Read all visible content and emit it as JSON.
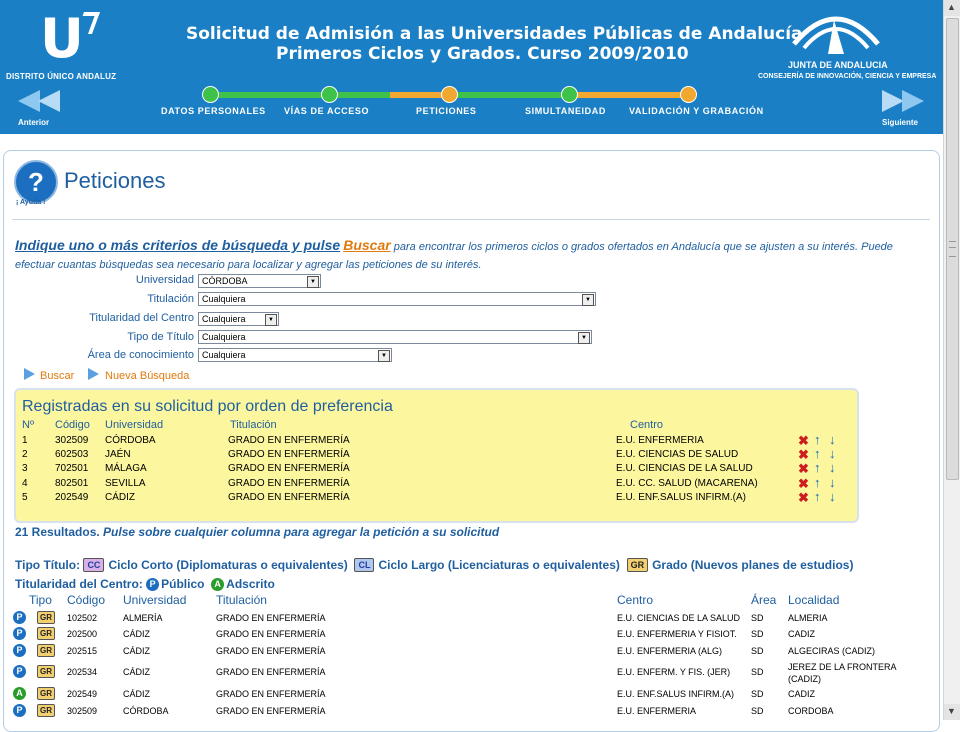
{
  "header": {
    "logo_letter": "U",
    "logo_text": "DISTRITO ÚNICO ANDALUZ",
    "title_line1": "Solicitud de Admisión a las Universidades Públicas de Andalucía",
    "title_line2": "Primeros Ciclos y Grados. Curso 2009/2010",
    "junta_name": "JUNTA DE ANDALUCIA",
    "junta_sub": "CONSEJERÍA DE INNOVACIÓN, CIENCIA Y EMPRESA",
    "prev_label": "Anterior",
    "next_label": "Siguiente",
    "colors": {
      "header_bg": "#1a7fc4",
      "step_done": "#3ec24a",
      "step_current": "#f0a830"
    }
  },
  "steps": [
    {
      "label": "DATOS PERSONALES",
      "state": "done"
    },
    {
      "label": "VÍAS DE ACCESO",
      "state": "done"
    },
    {
      "label": "PETICIONES",
      "state": "current"
    },
    {
      "label": "SIMULTANEIDAD",
      "state": "done"
    },
    {
      "label": "VALIDACIÓN Y GRABACIÓN",
      "state": "current"
    }
  ],
  "page": {
    "help_label": "¡ Ayuda !",
    "title": "Peticiones"
  },
  "instructions": {
    "lead": "Indique uno o más criterios de búsqueda y pulse",
    "keyword": "Buscar",
    "rest": " para encontrar los primeros ciclos o grados ofertados en Andalucía que se ajusten a su interés. Puede efectuar cuantas búsquedas sea necesario para localizar y agregar las peticiones de su interés."
  },
  "filters": {
    "universidad": {
      "label": "Universidad",
      "value": "CÓRDOBA"
    },
    "titulacion": {
      "label": "Titulación",
      "value": "Cualquiera"
    },
    "titularidad": {
      "label": "Titularidad del Centro",
      "value": "Cualquiera"
    },
    "tipo_titulo": {
      "label": "Tipo de Título",
      "value": "Cualquiera"
    },
    "area": {
      "label": "Área de conocimiento",
      "value": "Cualquiera"
    }
  },
  "actions": {
    "search": "Buscar",
    "new_search": "Nueva Búsqueda"
  },
  "registered": {
    "title": "Registradas en su solicitud por orden de preferencia",
    "headers": {
      "num": "Nº",
      "code": "Código",
      "univ": "Universidad",
      "degree": "Titulación",
      "center": "Centro"
    },
    "rows": [
      {
        "num": "1",
        "code": "302509",
        "univ": "CÓRDOBA",
        "degree": "GRADO EN ENFERMERÍA",
        "center": "E.U. ENFERMERIA"
      },
      {
        "num": "2",
        "code": "602503",
        "univ": "JAÉN",
        "degree": "GRADO EN ENFERMERÍA",
        "center": "E.U. CIENCIAS DE SALUD"
      },
      {
        "num": "3",
        "code": "702501",
        "univ": "MÁLAGA",
        "degree": "GRADO EN ENFERMERÍA",
        "center": "E.U. CIENCIAS DE LA SALUD"
      },
      {
        "num": "4",
        "code": "802501",
        "univ": "SEVILLA",
        "degree": "GRADO EN ENFERMERÍA",
        "center": "E.U. CC. SALUD (MACARENA)"
      },
      {
        "num": "5",
        "code": "202549",
        "univ": "CÁDIZ",
        "degree": "GRADO EN ENFERMERÍA",
        "center": "E.U. ENF.SALUS INFIRM.(A)"
      }
    ]
  },
  "results": {
    "count": "21 Resultados.",
    "hint": "Pulse sobre cualquier columna para agregar la petición a su solicitud",
    "legend_type_label": "Tipo Título:",
    "legend_cc_badge": "CC",
    "legend_cc_text": "Ciclo Corto (Diplomaturas o equivalentes)",
    "legend_cl_badge": "CL",
    "legend_cl_text": "Ciclo Largo (Licenciaturas o equivalentes)",
    "legend_gr_badge": "GR",
    "legend_gr_text": "Grado (Nuevos planes de estudios)",
    "legend_own_label": "Titularidad del Centro:",
    "legend_public_icon": "P",
    "legend_public": "Público",
    "legend_assigned_icon": "A",
    "legend_assigned": "Adscrito",
    "headers": {
      "tipo": "Tipo",
      "code": "Código",
      "univ": "Universidad",
      "degree": "Titulación",
      "center": "Centro",
      "area": "Área",
      "locality": "Localidad"
    },
    "rows": [
      {
        "own": "P",
        "type": "GR",
        "code": "102502",
        "univ": "ALMERÍA",
        "degree": "GRADO EN ENFERMERÍA",
        "center": "E.U. CIENCIAS DE LA SALUD",
        "area": "SD",
        "locality": "ALMERIA"
      },
      {
        "own": "P",
        "type": "GR",
        "code": "202500",
        "univ": "CÁDIZ",
        "degree": "GRADO EN ENFERMERÍA",
        "center": "E.U. ENFERMERIA Y FISIOT.",
        "area": "SD",
        "locality": "CADIZ"
      },
      {
        "own": "P",
        "type": "GR",
        "code": "202515",
        "univ": "CÁDIZ",
        "degree": "GRADO EN ENFERMERÍA",
        "center": "E.U. ENFERMERIA (ALG)",
        "area": "SD",
        "locality": "ALGECIRAS (CADIZ)"
      },
      {
        "own": "P",
        "type": "GR",
        "code": "202534",
        "univ": "CÁDIZ",
        "degree": "GRADO EN ENFERMERÍA",
        "center": "E.U. ENFERM. Y FIS. (JER)",
        "area": "SD",
        "locality": "JEREZ DE LA FRONTERA (CADIZ)"
      },
      {
        "own": "A",
        "type": "GR",
        "code": "202549",
        "univ": "CÁDIZ",
        "degree": "GRADO EN ENFERMERÍA",
        "center": "E.U. ENF.SALUS INFIRM.(A)",
        "area": "SD",
        "locality": "CADIZ"
      },
      {
        "own": "P",
        "type": "GR",
        "code": "302509",
        "univ": "CÓRDOBA",
        "degree": "GRADO EN ENFERMERÍA",
        "center": "E.U. ENFERMERIA",
        "area": "SD",
        "locality": "CORDOBA"
      }
    ]
  }
}
